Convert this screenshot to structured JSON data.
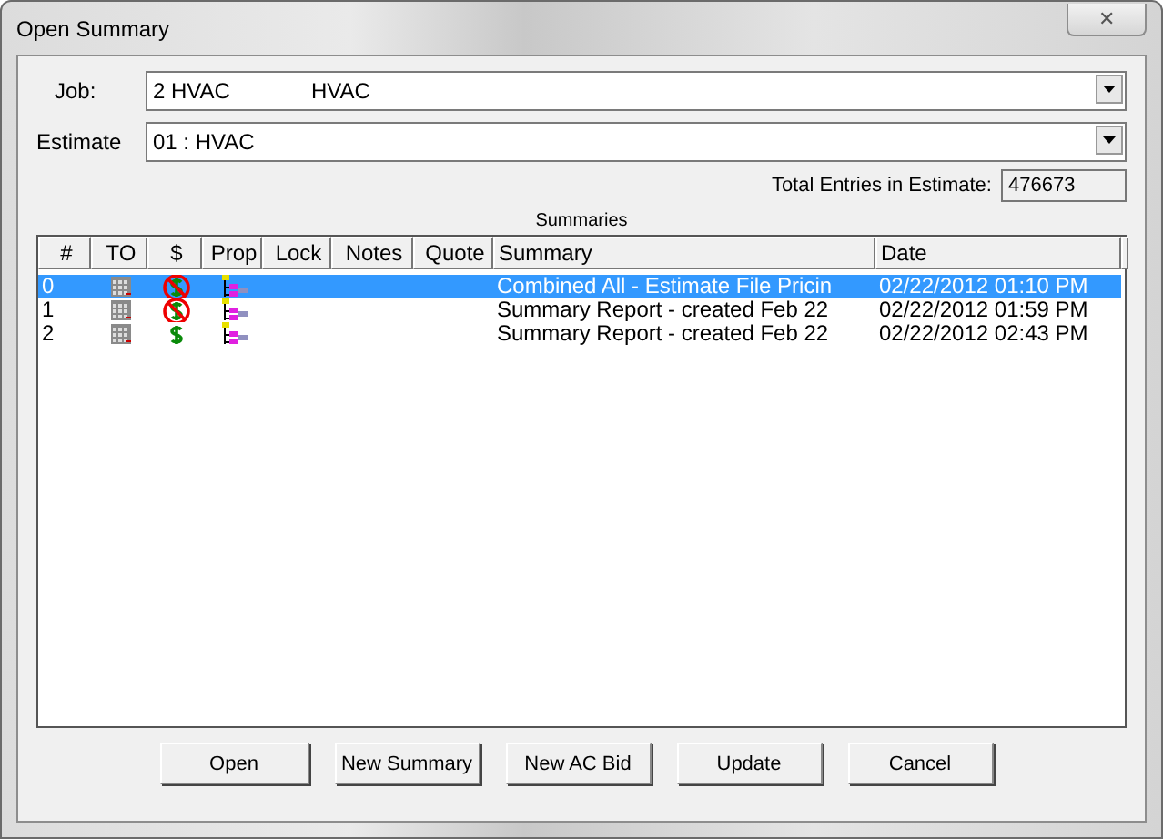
{
  "window": {
    "title": "Open Summary",
    "close": "✕"
  },
  "job": {
    "label": "Job:",
    "value": "2 HVAC",
    "value_2": "HVAC"
  },
  "estimate": {
    "label": "Estimate",
    "value": "01 : HVAC"
  },
  "total": {
    "label": "Total Entries in Estimate:",
    "value": "476673"
  },
  "summaries": {
    "title": "Summaries",
    "columns": [
      "#",
      "TO",
      "$",
      "Prop",
      "Lock",
      "Notes",
      "Quote",
      "Summary",
      "Date"
    ],
    "rows": [
      {
        "number": "0",
        "no_price": true,
        "summary": "Combined All - Estimate File Pricin",
        "date": "02/22/2012 01:10 PM",
        "selected": true
      },
      {
        "number": "1",
        "no_price": true,
        "summary": "Summary Report - created Feb 22",
        "date": "02/22/2012 01:59 PM",
        "selected": false
      },
      {
        "number": "2",
        "no_price": false,
        "summary": "Summary Report - created Feb 22",
        "date": "02/22/2012 02:43 PM",
        "selected": false
      }
    ]
  },
  "buttons": [
    "Open",
    "New Summary",
    "New AC Bid",
    "Update",
    "Cancel"
  ]
}
